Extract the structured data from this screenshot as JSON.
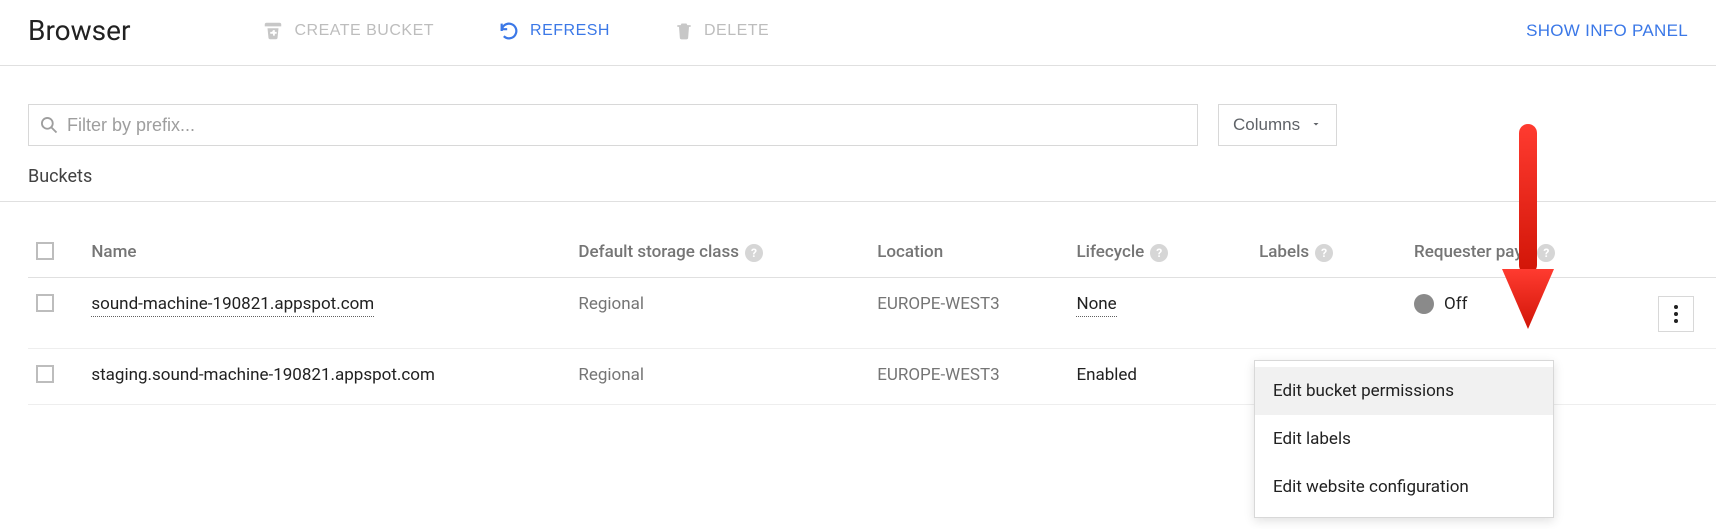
{
  "header": {
    "title": "Browser",
    "create_label": "CREATE BUCKET",
    "refresh_label": "REFRESH",
    "delete_label": "DELETE",
    "info_panel_label": "SHOW INFO PANEL"
  },
  "filter": {
    "placeholder": "Filter by prefix...",
    "value": ""
  },
  "columns_button": "Columns",
  "section_heading": "Buckets",
  "table": {
    "headers": {
      "name": "Name",
      "storage_class": "Default storage class",
      "location": "Location",
      "lifecycle": "Lifecycle",
      "labels": "Labels",
      "requester_pays": "Requester pays"
    },
    "rows": [
      {
        "name": "sound-machine-190821.appspot.com",
        "storage_class": "Regional",
        "location": "EUROPE-WEST3",
        "lifecycle": "None",
        "labels": "",
        "requester_pays": "Off",
        "requester_dot_color": "#8a8a8a",
        "has_kebab": true
      },
      {
        "name": "staging.sound-machine-190821.appspot.com",
        "storage_class": "Regional",
        "location": "EUROPE-WEST3",
        "lifecycle": "Enabled",
        "labels": "",
        "requester_pays": "",
        "has_kebab": false
      }
    ]
  },
  "context_menu": {
    "items": [
      "Edit bucket permissions",
      "Edit labels",
      "Edit website configuration"
    ]
  }
}
